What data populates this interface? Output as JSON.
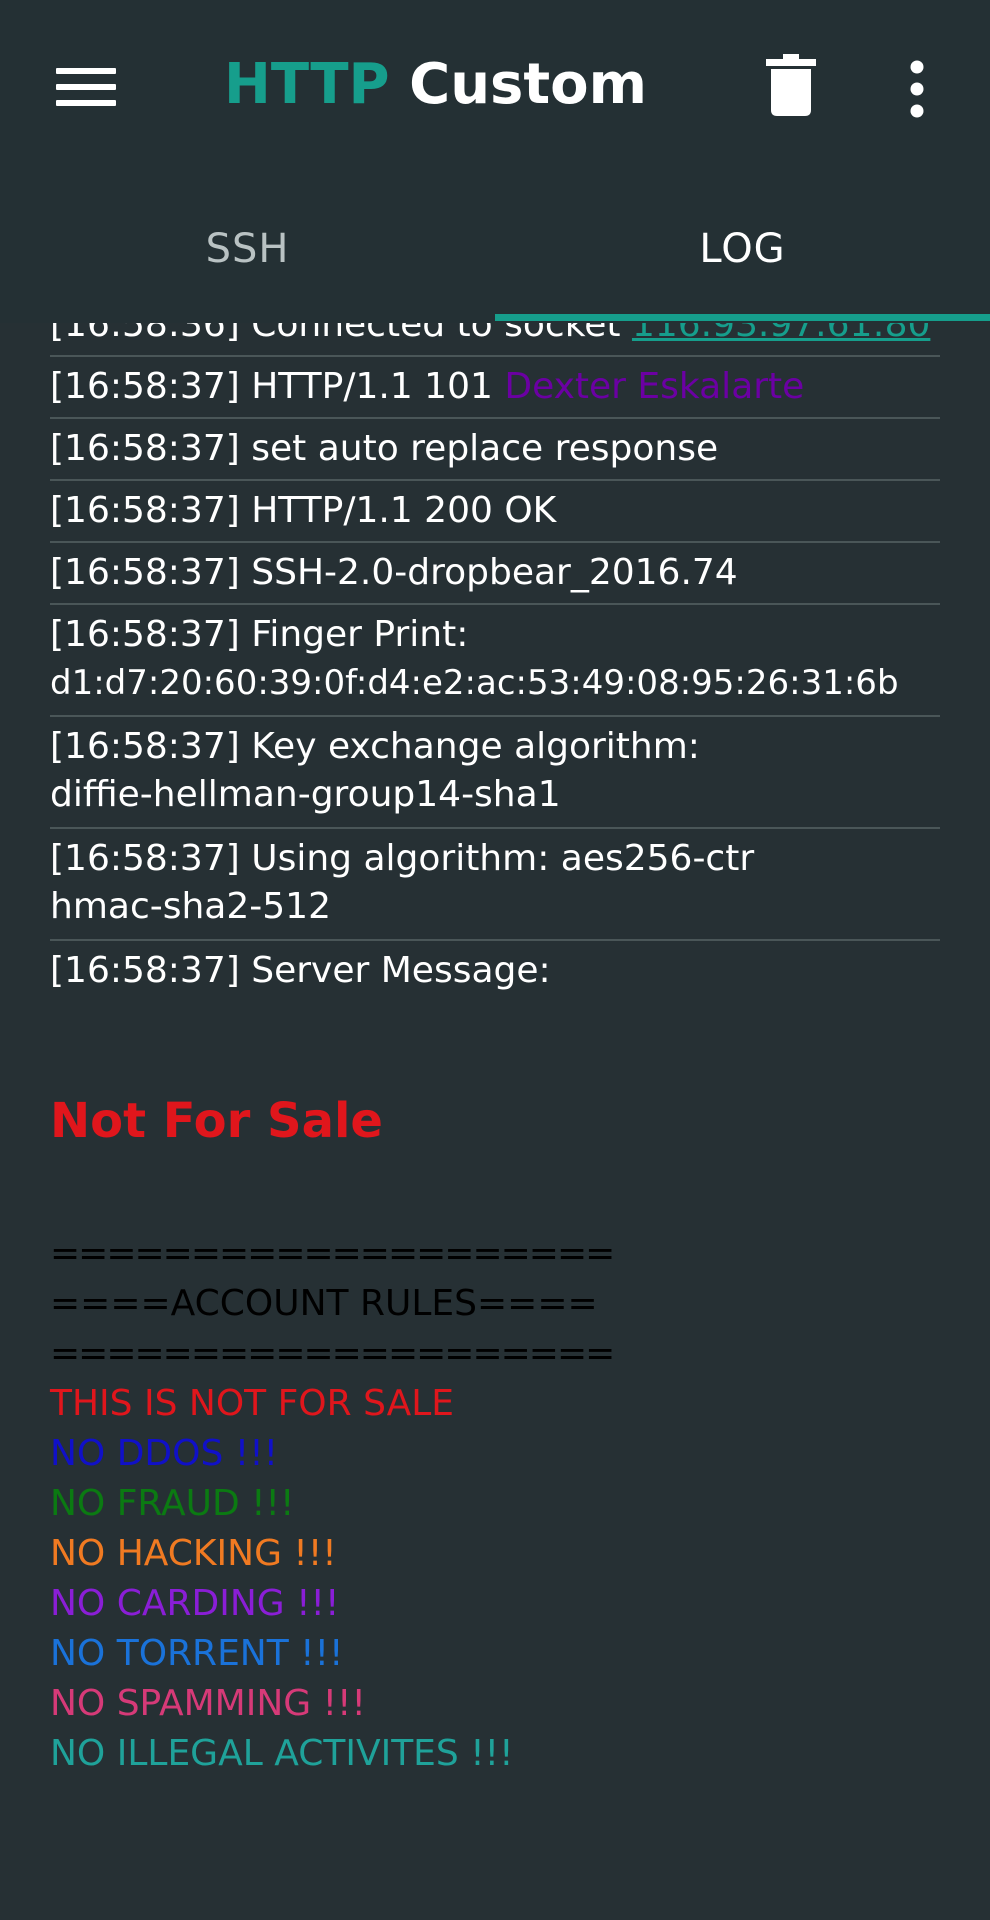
{
  "app": {
    "title_accent": "HTTP",
    "title_rest": "Custom"
  },
  "tabs": [
    {
      "label": "SSH"
    },
    {
      "label": "LOG"
    }
  ],
  "log": {
    "entries": [
      {
        "time": "[16:58:36]",
        "text": "Connected to socket",
        "link": "116.93.97.61:80"
      },
      {
        "time": "[16:58:37]",
        "text": "HTTP/1.1 101",
        "name": "Dexter Eskalarte"
      },
      {
        "time": "[16:58:37]",
        "text": "set auto replace response"
      },
      {
        "time": "[16:58:37]",
        "text": "HTTP/1.1 200 OK"
      },
      {
        "time": "[16:58:37]",
        "text": "SSH-2.0-dropbear_2016.74"
      },
      {
        "time": "[16:58:37]",
        "text": "Finger Print:",
        "line2": "d1:d7:20:60:39:0f:d4:e2:ac:53:49:08:95:26:31:6b"
      },
      {
        "time": "[16:58:37]",
        "text": "Key exchange algorithm:",
        "line2": "diffie-hellman-group14-sha1"
      },
      {
        "time": "[16:58:37]",
        "text": "Using algorithm: aes256-ctr",
        "line2": "hmac-sha2-512"
      },
      {
        "time": "[16:58:37]",
        "text": "Server Message:"
      }
    ],
    "server_message": {
      "headline": "Not For Sale",
      "separator": "====================",
      "rules_header": "====ACCOUNT RULES====",
      "rules": [
        {
          "text": "THIS IS NOT FOR SALE",
          "color": "#e0161c"
        },
        {
          "text": "NO DDOS !!!",
          "color": "#1010c8"
        },
        {
          "text": "NO FRAUD !!!",
          "color": "#0b7a12"
        },
        {
          "text": "NO HACKING !!!",
          "color": "#f07a22"
        },
        {
          "text": "NO CARDING !!!",
          "color": "#8a1ed6"
        },
        {
          "text": "NO TORRENT !!!",
          "color": "#1a72d9"
        },
        {
          "text": "NO SPAMMING !!!",
          "color": "#d63a78"
        },
        {
          "text": "NO ILLEGAL ACTIVITES !!!",
          "color": "#1fa29a"
        }
      ]
    }
  },
  "icons": {
    "menu": "menu-icon",
    "trash": "trash-icon",
    "more": "more-vert-icon"
  },
  "colors": {
    "accent": "#169e8c",
    "background": "#263034",
    "toolbar": "#243034"
  }
}
